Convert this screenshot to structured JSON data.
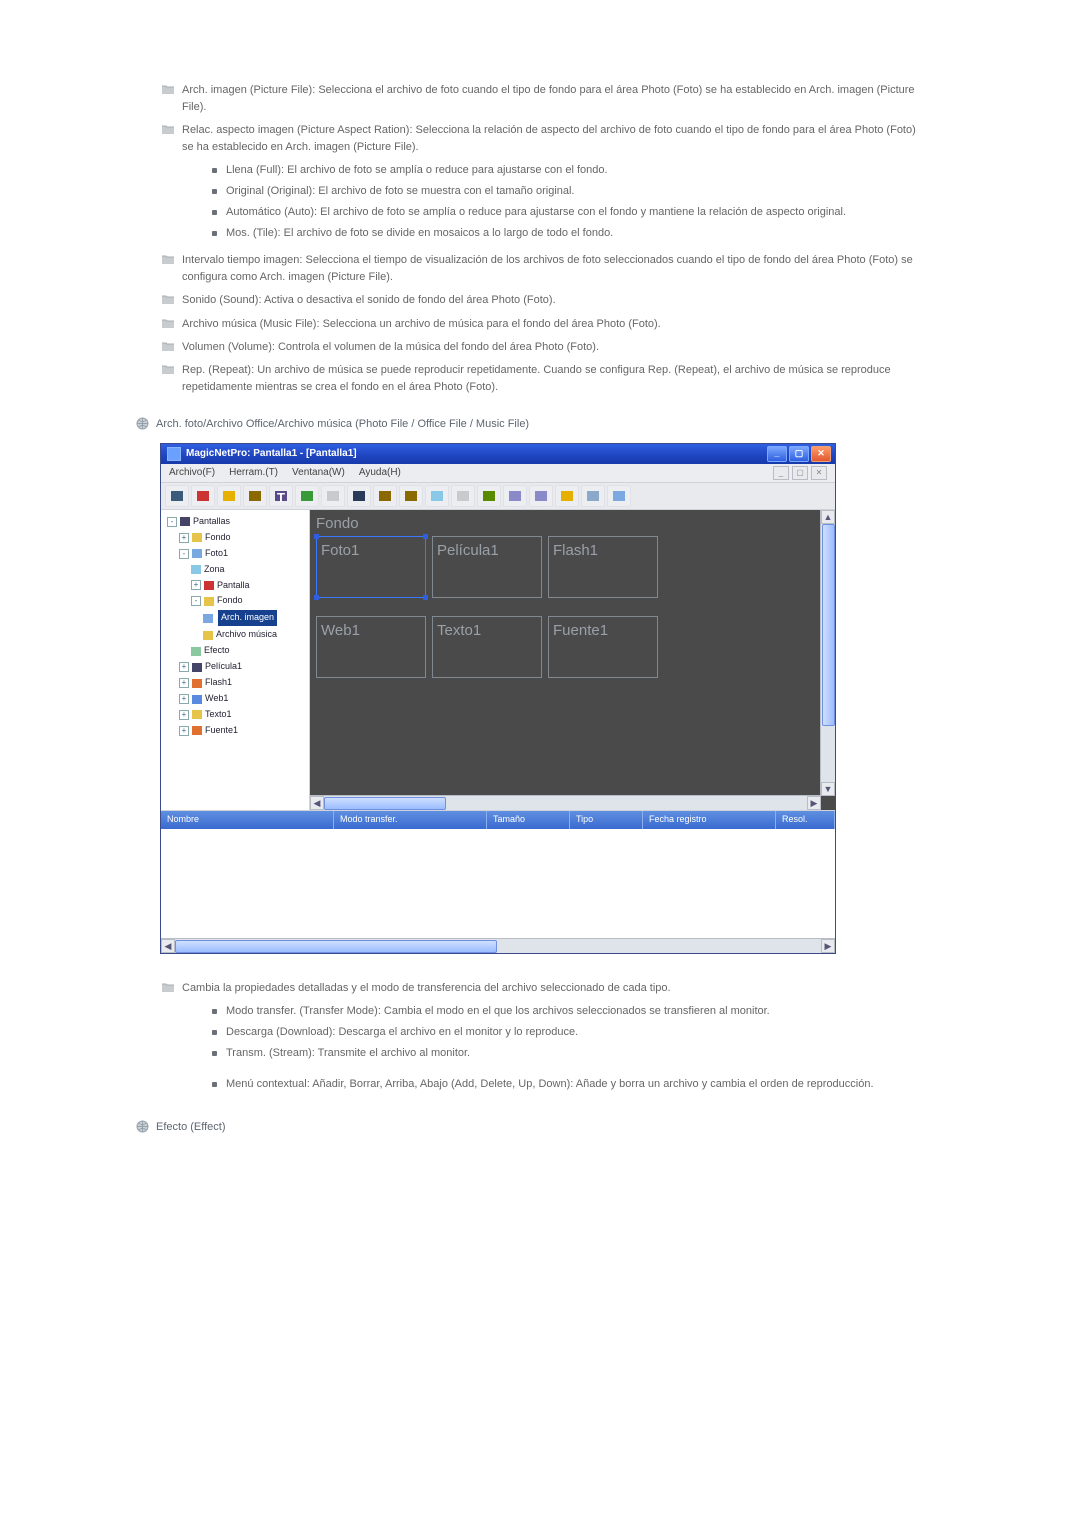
{
  "list1": {
    "item1": "Arch. imagen (Picture File): Selecciona el archivo de foto cuando el tipo de fondo para el área Photo (Foto) se ha establecido en Arch. imagen (Picture File).",
    "item2": "Relac. aspecto imagen (Picture Aspect Ration): Selecciona la relación de aspecto del archivo de foto cuando el tipo de fondo para el área Photo (Foto) se ha establecido en Arch. imagen (Picture File).",
    "item2_sub": {
      "a": "Llena (Full): El archivo de foto se amplía o reduce para ajustarse con el fondo.",
      "b": "Original (Original): El archivo de foto se muestra con el tamaño original.",
      "c": "Automático (Auto): El archivo de foto se amplía o reduce para ajustarse con el fondo y mantiene la relación de aspecto original.",
      "d": "Mos. (Tile): El archivo de foto se divide en mosaicos a lo largo de todo el fondo."
    },
    "item3": "Intervalo tiempo imagen: Selecciona el tiempo de visualización de los archivos de foto seleccionados cuando el tipo de fondo del área Photo (Foto) se configura como Arch. imagen (Picture File).",
    "item4": "Sonido (Sound): Activa o desactiva el sonido de fondo del área Photo (Foto).",
    "item5": "Archivo música (Music File): Selecciona un archivo de música para el fondo del área Photo (Foto).",
    "item6": "Volumen (Volume): Controla el volumen de la música del fondo del área Photo (Foto).",
    "item7": "Rep. (Repeat): Un archivo de música se puede reproducir repetidamente. Cuando se configura Rep. (Repeat), el archivo de música se reproduce repetidamente mientras se crea el fondo en el área Photo (Foto)."
  },
  "section_head1": "Arch. foto/Archivo Office/Archivo música (Photo File / Office File / Music File)",
  "screenshot": {
    "title": "MagicNetPro: Pantalla1 - [Pantalla1]",
    "menus": {
      "m1": "Archivo(F)",
      "m2": "Herram.(T)",
      "m3": "Ventana(W)",
      "m4": "Ayuda(H)"
    },
    "tree": {
      "n_pantallas": "Pantallas",
      "n_fondo": "Fondo",
      "n_foto1": "Foto1",
      "n_zona": "Zona",
      "n_pantalla": "Pantalla",
      "n_fondo2": "Fondo",
      "n_arch_imagen": "Arch. imagen",
      "n_arch_musica": "Archivo música",
      "n_efecto": "Efecto",
      "n_pelicula1": "Película1",
      "n_flash1": "Flash1",
      "n_web1": "Web1",
      "n_texto1": "Texto1",
      "n_fuente1": "Fuente1"
    },
    "canvas": {
      "frame_label": "Fondo",
      "foto1": "Foto1",
      "pelicula1": "Película1",
      "flash1": "Flash1",
      "web1": "Web1",
      "texto1": "Texto1",
      "fuente1": "Fuente1"
    },
    "grid": {
      "c1": "Nombre",
      "c2": "Modo transfer.",
      "c3": "Tamaño",
      "c4": "Tipo",
      "c5": "Fecha registro",
      "c6": "Resol."
    }
  },
  "list2": {
    "item1": "Cambia la propiedades detalladas y el modo de transferencia del archivo seleccionado de cada tipo.",
    "sub": {
      "a": "Modo transfer. (Transfer Mode): Cambia el modo en el que los archivos seleccionados se transfieren al monitor.",
      "b": "Descarga (Download): Descarga el archivo en el monitor y lo reproduce.",
      "c": "Transm. (Stream): Transmite el archivo al monitor.",
      "d": "Menú contextual: Añadir, Borrar, Arriba, Abajo (Add, Delete, Up, Down): Añade y borra un archivo y cambia el orden de reproducción."
    }
  },
  "section_head2": "Efecto (Effect)"
}
